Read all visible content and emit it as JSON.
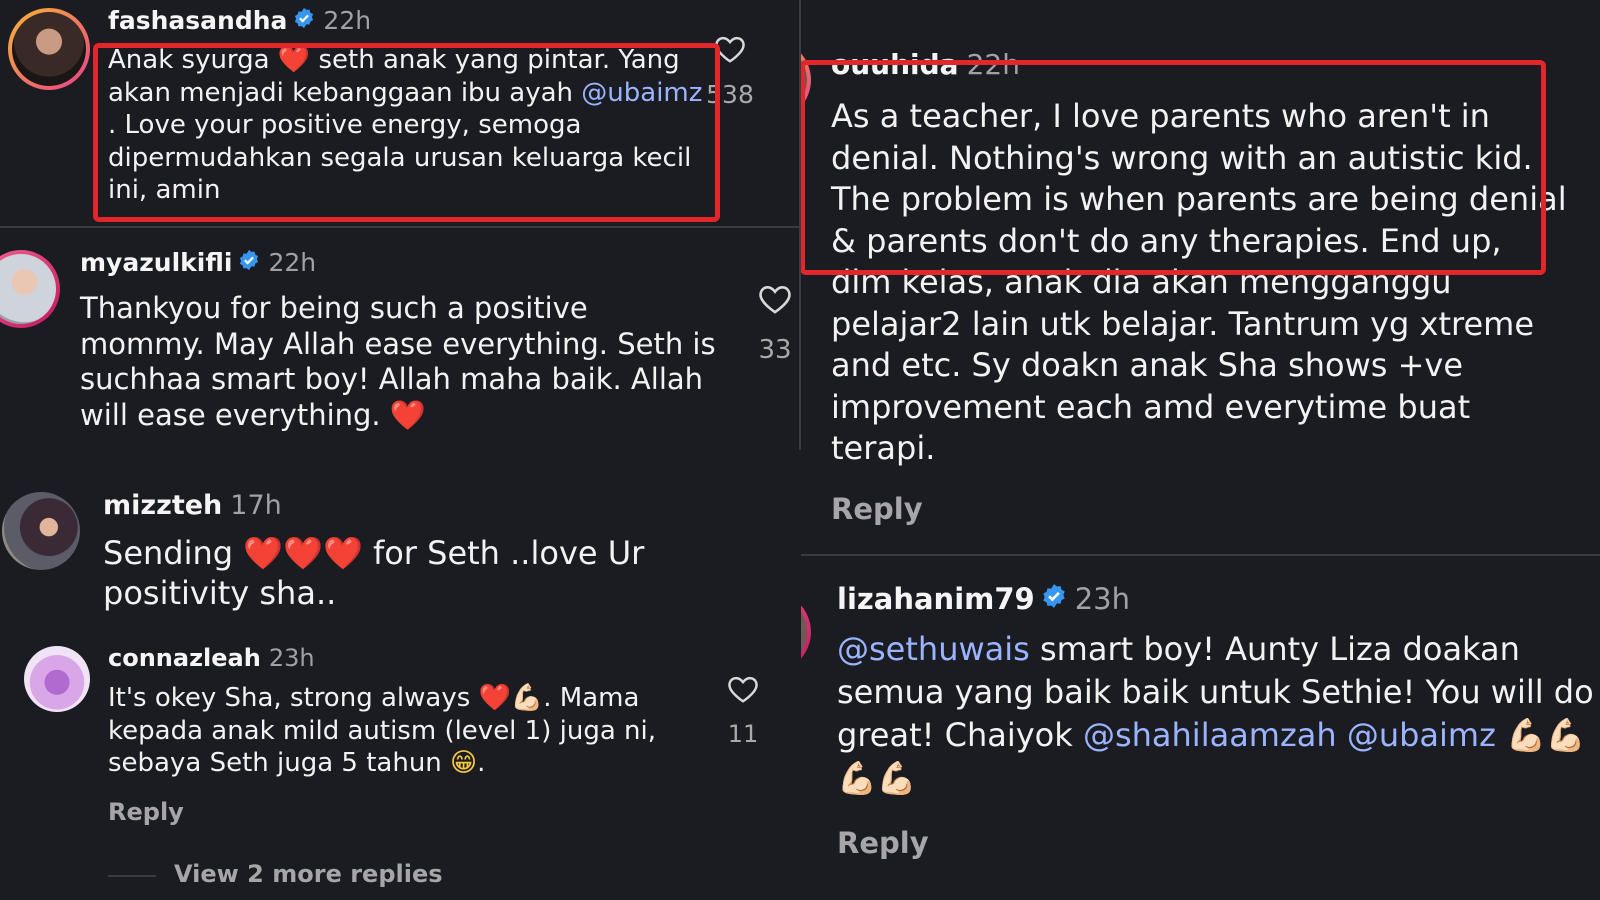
{
  "left": {
    "comment1": {
      "username": "fashasandha",
      "time": "22h",
      "text_a": "Anak syurga ",
      "text_b": " seth anak yang pintar. Yang akan menjadi kebanggaan ibu ayah ",
      "mention": "@ubaimz",
      "text_c": " . Love your positive energy, semoga dipermudahkan segala urusan keluarga kecil ini, amin",
      "likes": "538"
    },
    "comment2": {
      "username": "myazulkifli",
      "time": "22h",
      "text": "Thankyou for being such a positive mommy. May Allah ease everything. Seth is suchhaa smart boy! Allah maha baik. Allah will ease everything. ",
      "likes": "33"
    },
    "comment3": {
      "username": "mizzteh",
      "time": "17h",
      "text_a": "Sending ",
      "text_b": " for Seth ..love Ur positivity sha.."
    },
    "comment4": {
      "username": "connazleah",
      "time": "23h",
      "text_a": "It's okey Sha, strong always ",
      "text_b": ". Mama kepada anak mild autism (level 1) juga ni, sebaya Seth juga 5 tahun ",
      "text_c": ".",
      "likes": "11",
      "reply": "Reply"
    },
    "view_more": "View 2 more replies"
  },
  "right": {
    "comment1": {
      "username": "ouuhida",
      "time": "22h",
      "text": "As a teacher, I love parents who aren't in denial. Nothing's wrong with an autistic kid. The problem is when parents are being denial & parents don't do any therapies. End up, dlm kelas, anak dia akan mengganggu pelajar2 lain utk belajar. Tantrum yg xtreme and etc. Sy doakn anak Sha shows +ve improvement each amd everytime buat terapi.",
      "reply": "Reply"
    },
    "comment2": {
      "username": "lizahanim79",
      "time": "23h",
      "mention1": "@sethuwais",
      "text_a": " smart boy! Aunty Liza doakan semua yang baik baik untuk Sethie! You will do great! Chaiyok ",
      "mention2": "@shahilaamzah",
      "mention3": "@ubaimz",
      "reply": "Reply"
    }
  },
  "emoji": {
    "heart": "❤️",
    "muscle": "💪🏻",
    "grin": "😁"
  },
  "colors": {
    "background": "#1b1c21",
    "mention": "#9ab4ff",
    "highlight_box": "#e3262a",
    "verified": "#3797f0"
  }
}
